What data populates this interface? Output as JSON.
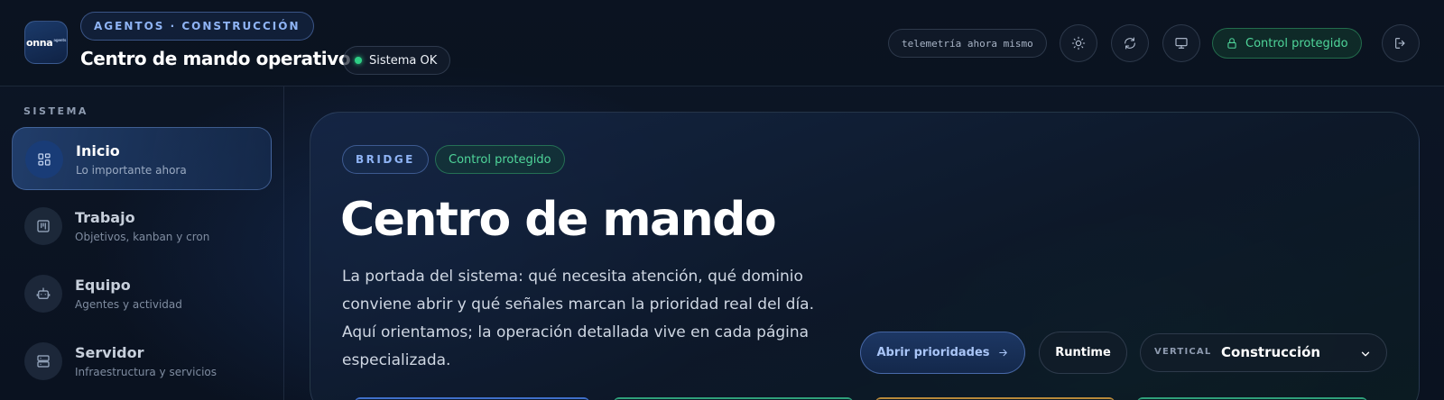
{
  "header": {
    "logo_text": "onna",
    "logo_sup": "agents",
    "kicker": "AGENTOS · CONSTRUCCIÓN",
    "title": "Centro de mando operativo",
    "status": "Sistema OK",
    "telemetry": "telemetría ahora mismo",
    "protected_label": "Control protegido",
    "icons": [
      "sun-icon",
      "refresh-icon",
      "monitor-icon",
      "lock-icon",
      "logout-icon"
    ]
  },
  "sidebar": {
    "heading": "SISTEMA",
    "items": [
      {
        "title": "Inicio",
        "subtitle": "Lo importante ahora",
        "icon": "grid-icon",
        "active": true
      },
      {
        "title": "Trabajo",
        "subtitle": "Objetivos, kanban y cron",
        "icon": "kanban-icon",
        "active": false
      },
      {
        "title": "Equipo",
        "subtitle": "Agentes y actividad",
        "icon": "robot-icon",
        "active": false
      },
      {
        "title": "Servidor",
        "subtitle": "Infraestructura y servicios",
        "icon": "server-icon",
        "active": false
      }
    ]
  },
  "main": {
    "tag_bridge": "BRIDGE",
    "tag_protected": "Control protegido",
    "title": "Centro de mando",
    "description": "La portada del sistema: qué necesita atención, qué dominio conviene abrir y qué señales marcan la prioridad real del día. Aquí orientamos; la operación detallada vive en cada página especializada.",
    "primary_button": "Abrir prioridades",
    "secondary_button": "Runtime",
    "vertical_label": "VERTICAL",
    "vertical_value": "Construcción"
  },
  "colors": {
    "accent_blue": "#8fb4f5",
    "accent_green": "#4fd69a",
    "background": "#0b1320"
  }
}
